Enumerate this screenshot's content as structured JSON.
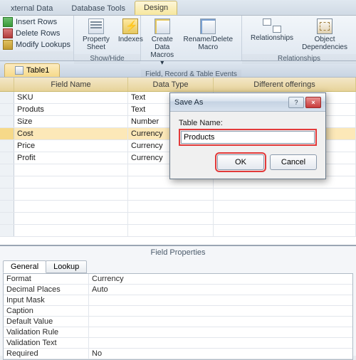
{
  "ribbon": {
    "tabs": {
      "external_data": "xternal Data",
      "database_tools": "Database Tools",
      "design": "Design"
    },
    "group_rows": {
      "insert": "Insert Rows",
      "delete": "Delete Rows",
      "modify": "Modify Lookups"
    },
    "show_hide": {
      "property_sheet": "Property\nSheet",
      "indexes": "Indexes",
      "label": "Show/Hide"
    },
    "events": {
      "create_macros": "Create Data\nMacros ▾",
      "rename_macro": "Rename/Delete\nMacro",
      "label": "Field, Record & Table Events"
    },
    "relationships": {
      "relationships": "Relationships",
      "dependencies": "Object\nDependencies",
      "label": "Relationships"
    }
  },
  "table_tab": "Table1",
  "columns": {
    "field_name": "Field Name",
    "data_type": "Data Type",
    "description": "Different offerings"
  },
  "fields": [
    {
      "name": "SKU",
      "type": "Text"
    },
    {
      "name": "Produts",
      "type": "Text"
    },
    {
      "name": "Size",
      "type": "Number"
    },
    {
      "name": "Cost",
      "type": "Currency"
    },
    {
      "name": "Price",
      "type": "Currency"
    },
    {
      "name": "Profit",
      "type": "Currency"
    }
  ],
  "selected_row_index": 3,
  "field_properties": {
    "title": "Field Properties",
    "tabs": {
      "general": "General",
      "lookup": "Lookup"
    },
    "rows": {
      "format": {
        "label": "Format",
        "value": "Currency"
      },
      "decimal": {
        "label": "Decimal Places",
        "value": "Auto"
      },
      "input_mask": {
        "label": "Input Mask",
        "value": ""
      },
      "caption": {
        "label": "Caption",
        "value": ""
      },
      "default_value": {
        "label": "Default Value",
        "value": ""
      },
      "validation_rule": {
        "label": "Validation Rule",
        "value": ""
      },
      "validation_text": {
        "label": "Validation Text",
        "value": ""
      },
      "required": {
        "label": "Required",
        "value": "No"
      }
    }
  },
  "dialog": {
    "title": "Save As",
    "help_glyph": "?",
    "close_glyph": "×",
    "label": "Table Name:",
    "input_value": "Products",
    "ok": "OK",
    "cancel": "Cancel"
  }
}
